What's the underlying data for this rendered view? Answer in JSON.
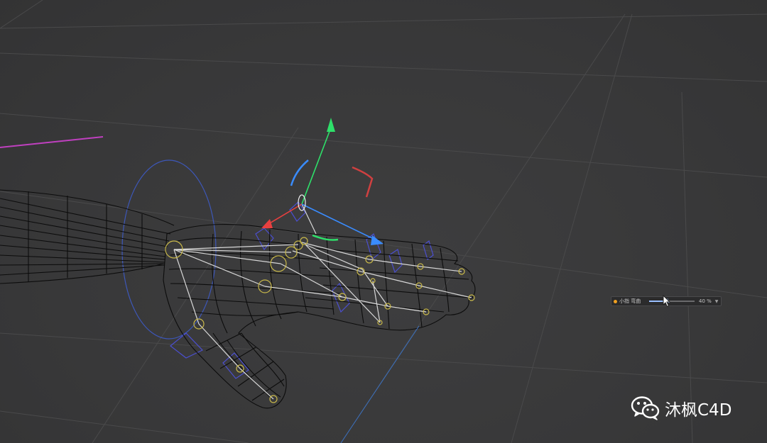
{
  "viewport": {
    "background": "#3a3a3b",
    "grid_color": "#4a4a4b",
    "wireframe_color": "#0c0c0c",
    "joint_color": "#c8b84a",
    "bone_color": "#d8d8d8",
    "ik_circle_color": "#3d57b8"
  },
  "gizmo": {
    "x_axis_color": "#e84040",
    "y_axis_color": "#2ee06a",
    "z_axis_color": "#3a8cff"
  },
  "hud": {
    "indicator_color": "#f0a020",
    "label": "小指 弯曲",
    "value": "40 %",
    "level": 0.4
  },
  "watermark": {
    "icon": "wechat-icon",
    "text": "沐枫C4D"
  }
}
